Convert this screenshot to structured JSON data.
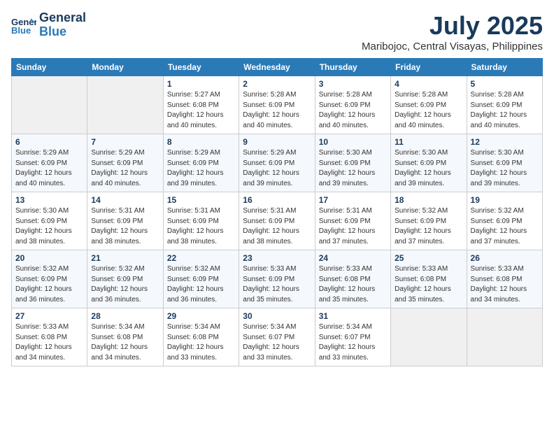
{
  "header": {
    "logo_line1": "General",
    "logo_line2": "Blue",
    "month": "July 2025",
    "location": "Maribojoc, Central Visayas, Philippines"
  },
  "weekdays": [
    "Sunday",
    "Monday",
    "Tuesday",
    "Wednesday",
    "Thursday",
    "Friday",
    "Saturday"
  ],
  "weeks": [
    [
      {
        "day": "",
        "sunrise": "",
        "sunset": "",
        "daylight": ""
      },
      {
        "day": "",
        "sunrise": "",
        "sunset": "",
        "daylight": ""
      },
      {
        "day": "1",
        "sunrise": "Sunrise: 5:27 AM",
        "sunset": "Sunset: 6:08 PM",
        "daylight": "Daylight: 12 hours and 40 minutes."
      },
      {
        "day": "2",
        "sunrise": "Sunrise: 5:28 AM",
        "sunset": "Sunset: 6:09 PM",
        "daylight": "Daylight: 12 hours and 40 minutes."
      },
      {
        "day": "3",
        "sunrise": "Sunrise: 5:28 AM",
        "sunset": "Sunset: 6:09 PM",
        "daylight": "Daylight: 12 hours and 40 minutes."
      },
      {
        "day": "4",
        "sunrise": "Sunrise: 5:28 AM",
        "sunset": "Sunset: 6:09 PM",
        "daylight": "Daylight: 12 hours and 40 minutes."
      },
      {
        "day": "5",
        "sunrise": "Sunrise: 5:28 AM",
        "sunset": "Sunset: 6:09 PM",
        "daylight": "Daylight: 12 hours and 40 minutes."
      }
    ],
    [
      {
        "day": "6",
        "sunrise": "Sunrise: 5:29 AM",
        "sunset": "Sunset: 6:09 PM",
        "daylight": "Daylight: 12 hours and 40 minutes."
      },
      {
        "day": "7",
        "sunrise": "Sunrise: 5:29 AM",
        "sunset": "Sunset: 6:09 PM",
        "daylight": "Daylight: 12 hours and 40 minutes."
      },
      {
        "day": "8",
        "sunrise": "Sunrise: 5:29 AM",
        "sunset": "Sunset: 6:09 PM",
        "daylight": "Daylight: 12 hours and 39 minutes."
      },
      {
        "day": "9",
        "sunrise": "Sunrise: 5:29 AM",
        "sunset": "Sunset: 6:09 PM",
        "daylight": "Daylight: 12 hours and 39 minutes."
      },
      {
        "day": "10",
        "sunrise": "Sunrise: 5:30 AM",
        "sunset": "Sunset: 6:09 PM",
        "daylight": "Daylight: 12 hours and 39 minutes."
      },
      {
        "day": "11",
        "sunrise": "Sunrise: 5:30 AM",
        "sunset": "Sunset: 6:09 PM",
        "daylight": "Daylight: 12 hours and 39 minutes."
      },
      {
        "day": "12",
        "sunrise": "Sunrise: 5:30 AM",
        "sunset": "Sunset: 6:09 PM",
        "daylight": "Daylight: 12 hours and 39 minutes."
      }
    ],
    [
      {
        "day": "13",
        "sunrise": "Sunrise: 5:30 AM",
        "sunset": "Sunset: 6:09 PM",
        "daylight": "Daylight: 12 hours and 38 minutes."
      },
      {
        "day": "14",
        "sunrise": "Sunrise: 5:31 AM",
        "sunset": "Sunset: 6:09 PM",
        "daylight": "Daylight: 12 hours and 38 minutes."
      },
      {
        "day": "15",
        "sunrise": "Sunrise: 5:31 AM",
        "sunset": "Sunset: 6:09 PM",
        "daylight": "Daylight: 12 hours and 38 minutes."
      },
      {
        "day": "16",
        "sunrise": "Sunrise: 5:31 AM",
        "sunset": "Sunset: 6:09 PM",
        "daylight": "Daylight: 12 hours and 38 minutes."
      },
      {
        "day": "17",
        "sunrise": "Sunrise: 5:31 AM",
        "sunset": "Sunset: 6:09 PM",
        "daylight": "Daylight: 12 hours and 37 minutes."
      },
      {
        "day": "18",
        "sunrise": "Sunrise: 5:32 AM",
        "sunset": "Sunset: 6:09 PM",
        "daylight": "Daylight: 12 hours and 37 minutes."
      },
      {
        "day": "19",
        "sunrise": "Sunrise: 5:32 AM",
        "sunset": "Sunset: 6:09 PM",
        "daylight": "Daylight: 12 hours and 37 minutes."
      }
    ],
    [
      {
        "day": "20",
        "sunrise": "Sunrise: 5:32 AM",
        "sunset": "Sunset: 6:09 PM",
        "daylight": "Daylight: 12 hours and 36 minutes."
      },
      {
        "day": "21",
        "sunrise": "Sunrise: 5:32 AM",
        "sunset": "Sunset: 6:09 PM",
        "daylight": "Daylight: 12 hours and 36 minutes."
      },
      {
        "day": "22",
        "sunrise": "Sunrise: 5:32 AM",
        "sunset": "Sunset: 6:09 PM",
        "daylight": "Daylight: 12 hours and 36 minutes."
      },
      {
        "day": "23",
        "sunrise": "Sunrise: 5:33 AM",
        "sunset": "Sunset: 6:09 PM",
        "daylight": "Daylight: 12 hours and 35 minutes."
      },
      {
        "day": "24",
        "sunrise": "Sunrise: 5:33 AM",
        "sunset": "Sunset: 6:08 PM",
        "daylight": "Daylight: 12 hours and 35 minutes."
      },
      {
        "day": "25",
        "sunrise": "Sunrise: 5:33 AM",
        "sunset": "Sunset: 6:08 PM",
        "daylight": "Daylight: 12 hours and 35 minutes."
      },
      {
        "day": "26",
        "sunrise": "Sunrise: 5:33 AM",
        "sunset": "Sunset: 6:08 PM",
        "daylight": "Daylight: 12 hours and 34 minutes."
      }
    ],
    [
      {
        "day": "27",
        "sunrise": "Sunrise: 5:33 AM",
        "sunset": "Sunset: 6:08 PM",
        "daylight": "Daylight: 12 hours and 34 minutes."
      },
      {
        "day": "28",
        "sunrise": "Sunrise: 5:34 AM",
        "sunset": "Sunset: 6:08 PM",
        "daylight": "Daylight: 12 hours and 34 minutes."
      },
      {
        "day": "29",
        "sunrise": "Sunrise: 5:34 AM",
        "sunset": "Sunset: 6:08 PM",
        "daylight": "Daylight: 12 hours and 33 minutes."
      },
      {
        "day": "30",
        "sunrise": "Sunrise: 5:34 AM",
        "sunset": "Sunset: 6:07 PM",
        "daylight": "Daylight: 12 hours and 33 minutes."
      },
      {
        "day": "31",
        "sunrise": "Sunrise: 5:34 AM",
        "sunset": "Sunset: 6:07 PM",
        "daylight": "Daylight: 12 hours and 33 minutes."
      },
      {
        "day": "",
        "sunrise": "",
        "sunset": "",
        "daylight": ""
      },
      {
        "day": "",
        "sunrise": "",
        "sunset": "",
        "daylight": ""
      }
    ]
  ]
}
